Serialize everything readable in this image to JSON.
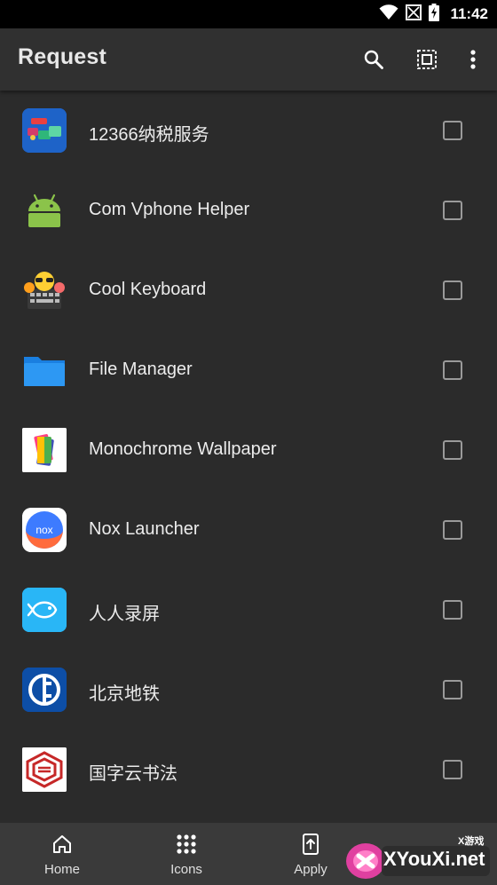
{
  "status_bar": {
    "time": "11:42",
    "icons": [
      "wifi-icon",
      "no-signal-icon",
      "battery-charging-icon"
    ]
  },
  "app_bar": {
    "title": "Request",
    "actions": [
      "search-icon",
      "select-all-icon",
      "more-vert-icon"
    ]
  },
  "apps": [
    {
      "name": "12366纳税服务",
      "icon": "tax-service-icon",
      "checked": false
    },
    {
      "name": "Com Vphone Helper",
      "icon": "android-icon",
      "checked": false
    },
    {
      "name": "Cool Keyboard",
      "icon": "emoji-keyboard-icon",
      "checked": false
    },
    {
      "name": "File Manager",
      "icon": "folder-icon",
      "checked": false
    },
    {
      "name": "Monochrome Wallpaper",
      "icon": "wallpaper-icon",
      "checked": false
    },
    {
      "name": "Nox Launcher",
      "icon": "nox-icon",
      "checked": false
    },
    {
      "name": "人人录屏",
      "icon": "fish-icon",
      "checked": false
    },
    {
      "name": "北京地铁",
      "icon": "subway-logo-icon",
      "checked": false
    },
    {
      "name": "国字云书法",
      "icon": "calligraphy-icon",
      "checked": false
    }
  ],
  "bottom_nav": {
    "items": [
      {
        "label": "Home",
        "icon": "home-icon"
      },
      {
        "label": "Icons",
        "icon": "grid-icon"
      },
      {
        "label": "Apply",
        "icon": "apply-icon"
      }
    ]
  },
  "watermark": {
    "text": "XYouXi.net",
    "small": "X游戏"
  },
  "colors": {
    "background": "#2b2b2b",
    "app_bar": "#303030",
    "bottom_nav": "#3a3a3a",
    "status_bar": "#000000",
    "checkbox_border": "#9a9a9a"
  }
}
